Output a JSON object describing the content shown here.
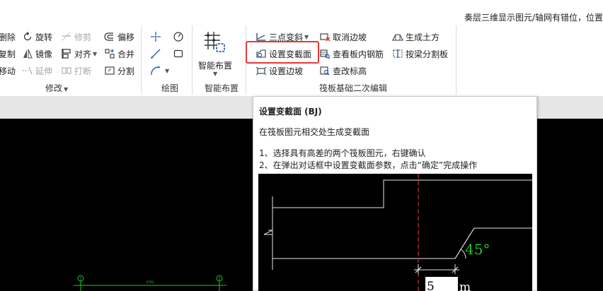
{
  "notice": "奏层三维显示图元/轴网有错位，位置",
  "modify": {
    "title": "修改",
    "delete": "删除",
    "copy": "复制",
    "move": "移动",
    "rotate": "旋转",
    "mirror": "镜像",
    "extend": "延伸",
    "trim": "修剪",
    "align": "对齐",
    "break": "打断",
    "offset": "偏移",
    "merge": "合并",
    "split": "分割"
  },
  "draw": {
    "title": "绘图"
  },
  "smart": {
    "title": "智能布置",
    "label": "智能布置"
  },
  "raft": {
    "title": "筏板基础二次编辑",
    "three_point_slope": "三点变斜",
    "set_section_change": "设置变截面",
    "set_slope": "设置边坡",
    "cancel_slope": "取消边坡",
    "view_rebar": "查看板内钢筋",
    "check_elevation": "查改标高",
    "generate_earthwork": "生成土方",
    "split_by_beam": "按梁分割板"
  },
  "tooltip": {
    "title": "设置变截面 (BJ)",
    "description": "在筏板图元相交处生成变截面",
    "step1": "1、选择具有高差的两个筏板图元，右键确认",
    "step2": "2、在弹出对话框中设置变截面参数，点击“确定”完成操作",
    "angle_label": "45°",
    "dim_value": "5",
    "dim_unit": "m"
  },
  "canvas": {
    "axis_1": "1",
    "axis_2": "2",
    "dim": "6700"
  },
  "colors": {
    "highlight": "#e53935",
    "accent_blue": "#1e5fb4",
    "cad_green": "#22c522",
    "cad_red": "#d03030"
  }
}
